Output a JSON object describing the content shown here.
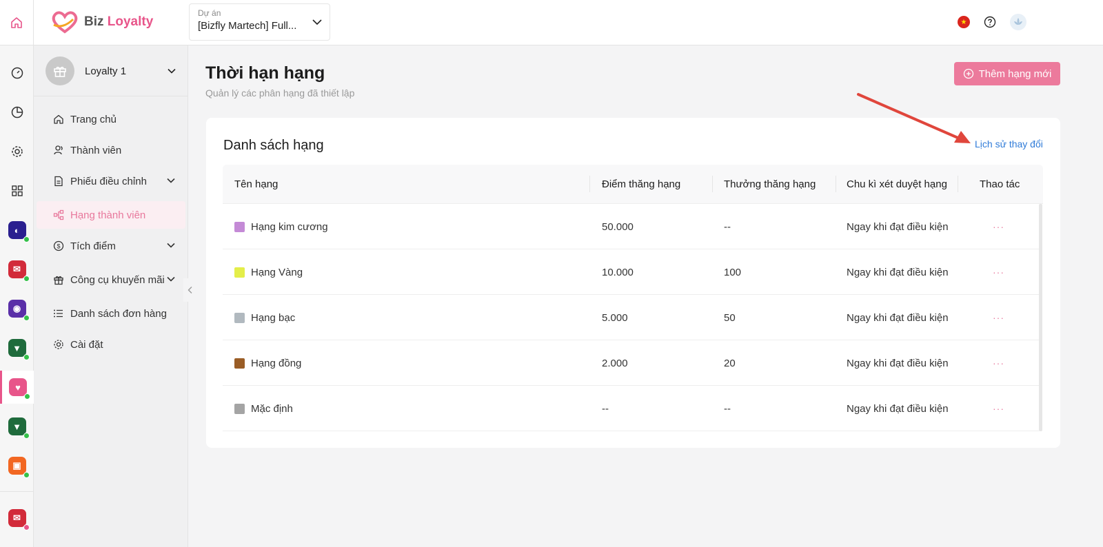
{
  "topbar": {
    "logo_text_biz": "Biz",
    "logo_text_loyalty": "Loyalty",
    "project_label": "Dự án",
    "project_value": "[Bizfly Martech] Full...",
    "language_flag": "vn-flag-icon"
  },
  "sidebar": {
    "org_name": "Loyalty 1",
    "items": [
      {
        "label": "Trang chủ",
        "icon": "home-icon"
      },
      {
        "label": "Thành viên",
        "icon": "users-icon"
      },
      {
        "label": "Phiếu điều chỉnh",
        "icon": "document-icon"
      },
      {
        "label": "Hạng thành viên",
        "icon": "hierarchy-icon"
      },
      {
        "label": "Tích điểm",
        "icon": "coin-icon"
      },
      {
        "label": "Công cụ khuyến mãi",
        "icon": "gift-icon"
      },
      {
        "label": "Danh sách đơn hàng",
        "icon": "list-icon"
      },
      {
        "label": "Cài đặt",
        "icon": "gear-icon"
      }
    ]
  },
  "page": {
    "title": "Thời hạn hạng",
    "subtitle": "Quản lý các phân hạng đã thiết lập",
    "add_button": "Thêm hạng mới"
  },
  "card": {
    "title": "Danh sách hạng",
    "history_link": "Lịch sử thay đổi",
    "columns": [
      "Tên hạng",
      "Điểm thăng hạng",
      "Thưởng thăng hạng",
      "Chu kì xét duyệt hạng",
      "Thao tác"
    ],
    "rows": [
      {
        "name": "Hạng kim cương",
        "color": "#c48ad6",
        "points": "50.000",
        "reward": "--",
        "cycle": "Ngay khi đạt điều kiện",
        "action": "···"
      },
      {
        "name": "Hạng Vàng",
        "color": "#e4ee4a",
        "points": "10.000",
        "reward": "100",
        "cycle": "Ngay khi đạt điều kiện",
        "action": "···"
      },
      {
        "name": "Hạng bạc",
        "color": "#b1b9bf",
        "points": "5.000",
        "reward": "50",
        "cycle": "Ngay khi đạt điều kiện",
        "action": "···"
      },
      {
        "name": "Hạng đồng",
        "color": "#9a5d26",
        "points": "2.000",
        "reward": "20",
        "cycle": "Ngay khi đạt điều kiện",
        "action": "···"
      },
      {
        "name": "Mặc định",
        "color": "#a4a4a4",
        "points": "--",
        "reward": "--",
        "cycle": "Ngay khi đạt điều kiện",
        "action": "···"
      }
    ]
  },
  "colors": {
    "accent": "#e8558a",
    "button": "#ec7a9c",
    "link": "#2f7bd8",
    "annotation_arrow": "#e0463c"
  }
}
